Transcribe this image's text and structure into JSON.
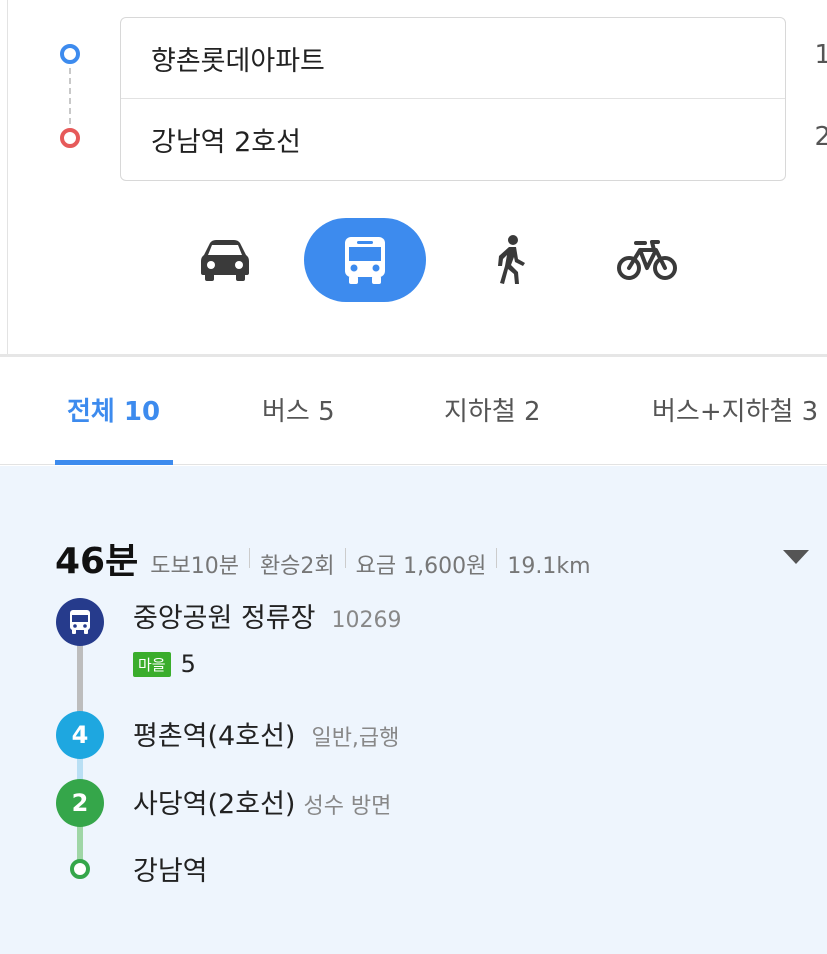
{
  "search": {
    "origin": "향촌롯데아파트",
    "destination": "강남역 2호선"
  },
  "edge_chars": [
    "1",
    "2"
  ],
  "modes": [
    {
      "name": "car",
      "icon": "car-icon",
      "active": false
    },
    {
      "name": "bus",
      "icon": "bus-icon",
      "active": true
    },
    {
      "name": "walk",
      "icon": "walk-icon",
      "active": false
    },
    {
      "name": "bike",
      "icon": "bike-icon",
      "active": false
    }
  ],
  "tabs": [
    {
      "label": "전체 10",
      "active": true
    },
    {
      "label": "버스 5",
      "active": false
    },
    {
      "label": "지하철 2",
      "active": false
    },
    {
      "label": "버스+지하철 3",
      "active": false
    }
  ],
  "result": {
    "total_time": "46분",
    "walk": "도보10분",
    "transfers": "환승2회",
    "fare": "요금 1,600원",
    "distance": "19.1km",
    "steps": [
      {
        "name": "중앙공원 정류장",
        "sub": "10269",
        "icon": "bus-icon"
      },
      {
        "name": "평촌역(4호선)",
        "sub": "일반,급행",
        "icon": "4"
      },
      {
        "name": "사당역(2호선)",
        "sub": "성수 방면",
        "icon": "2"
      },
      {
        "name": "강남역",
        "sub": "",
        "icon": "end-dot-icon"
      }
    ],
    "bus_badge": "마을",
    "bus_number": "5"
  },
  "colors": {
    "accent": "#3d8bee",
    "origin": "#3d8bee",
    "destination": "#e65a5a",
    "bus_stop": "#263b8c",
    "line4": "#1ea7e0",
    "line2": "#35a64a",
    "village_bus": "#3aad2c"
  }
}
